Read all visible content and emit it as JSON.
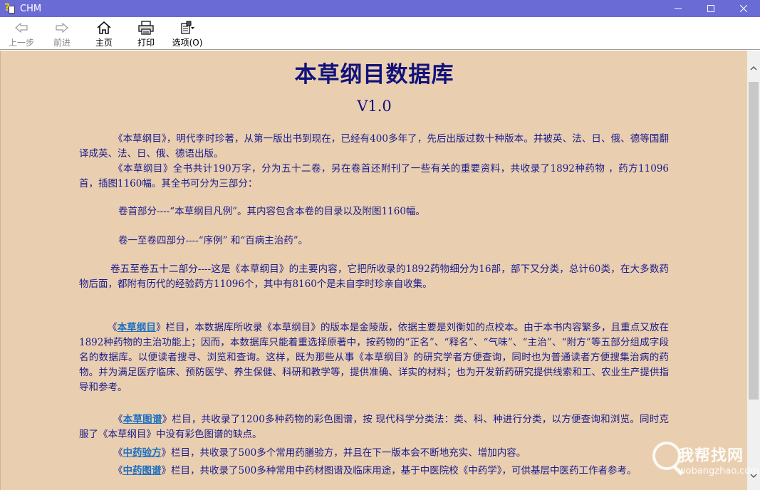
{
  "window": {
    "title": "CHM"
  },
  "toolbar": {
    "back_label": "上一步",
    "forward_label": "前进",
    "home_label": "主页",
    "print_label": "打印",
    "options_label": "选项(O)"
  },
  "document": {
    "title": "本草纲目数据库",
    "version": "V1.0",
    "p1": "《本草纲目》，明代李时珍著，从第一版出书到现在，已经有400多年了，先后出版过数十种版本。并被英、法、日、俄、德等国翻译成英、法、日、俄、德语出版。",
    "p2": "《本草纲目》全书共计190万字，分为五十二卷，另在卷首还附刊了一些有关的重要资料，共收录了1892种药物 ，药方11096首，插图1160幅。其全书可分为三部分：",
    "part1": "卷首部分----“本草纲目凡例”。其内容包含本卷的目录以及附图1160幅。",
    "part2": "卷一至卷四部分----“序例” 和“百病主治药”。",
    "p3": "卷五至卷五十二部分----这是《本草纲目》的主要内容，它把所收录的1892药物细分为16部，部下又分类，总计60类，在大多数药物后面，都附有历代的经验药方11096个，其中有8160个是未自李时珍亲自收集。",
    "s1_pre": "《",
    "s1_link": "本草纲目",
    "s1_post": "》栏目，本数据库所收录《本草纲目》的版本是金陵版，依据主要是刘衡如的点校本。由于本书内容繁多，且重点又放在1892种药物的主治功能上；因而，本数据库只能着重选择原著中，按药物的“正名”、“释名”、“气味”、“主治”、“附方”等五部分组成字段名的数据库。以便读者搜寻、浏览和查询。这样，既为那些从事《本草纲目》的研究学者方便查询，同时也为普通读者方便搜集治病的药物。并为满足医疗临床、预防医学、养生保健、科研和教学等，提供准确、详实的材料；也为开发新药研究提供线索和工、农业生产提供指导和参考。",
    "s2_pre": "《",
    "s2_link": "本草图谱",
    "s2_post": "》栏目，共收录了1200多种药物的彩色图谱，按 现代科学分类法：类、科、种进行分类，以方便查询和浏览。同时克服了《本草纲目》中没有彩色图谱的缺点。",
    "s3_pre": "《",
    "s3_link": "中药验方",
    "s3_post": "》栏目，共收录了500多个常用药膳验方，并且在下一版本会不断地充实、增加内容。",
    "s4_pre": "《",
    "s4_link": "中药图谱",
    "s4_post": "》栏目，共收录了500多种常用中药材图谱及临床用途，基于中医院校《中药学》，可供基层中医药工作者参考。"
  },
  "watermark": {
    "cn": "我帮找网",
    "en": "wobangzhao.com"
  },
  "colors": {
    "titlebar": "#6b6bd6",
    "content_bg": "#e9cfb0",
    "text": "#1a1a8c",
    "link": "#1a6ec0"
  }
}
